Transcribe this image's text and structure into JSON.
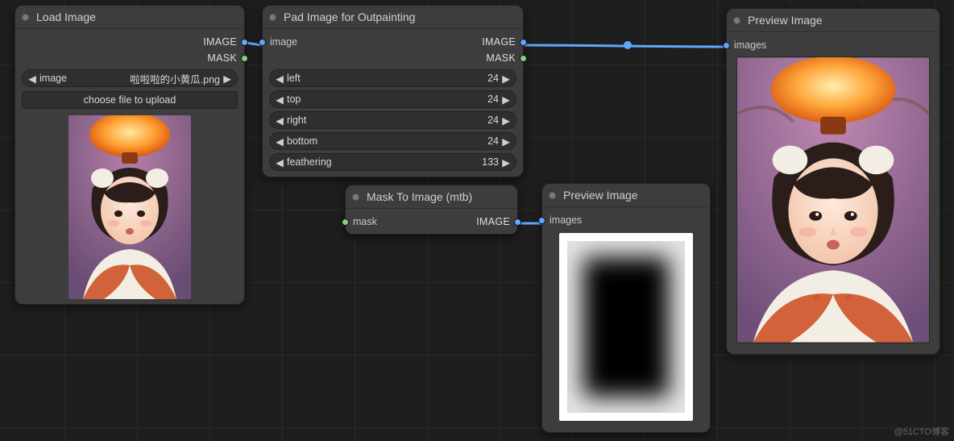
{
  "nodes": {
    "load_image": {
      "title": "Load Image",
      "outputs": {
        "image": "IMAGE",
        "mask": "MASK"
      },
      "file_widget": {
        "label": "image",
        "value": "啦啦啦的小黄瓜.png"
      },
      "upload_btn": "choose file to upload"
    },
    "pad_outpaint": {
      "title": "Pad Image for Outpainting",
      "inputs": {
        "image": "image"
      },
      "outputs": {
        "image": "IMAGE",
        "mask": "MASK"
      },
      "widgets": [
        {
          "label": "left",
          "value": "24"
        },
        {
          "label": "top",
          "value": "24"
        },
        {
          "label": "right",
          "value": "24"
        },
        {
          "label": "bottom",
          "value": "24"
        },
        {
          "label": "feathering",
          "value": "133"
        }
      ]
    },
    "mask_to_image": {
      "title": "Mask To Image (mtb)",
      "inputs": {
        "mask": "mask"
      },
      "outputs": {
        "image": "IMAGE"
      }
    },
    "preview_mask": {
      "title": "Preview Image",
      "inputs": {
        "images": "images"
      }
    },
    "preview_big": {
      "title": "Preview Image",
      "inputs": {
        "images": "images"
      }
    }
  },
  "watermark": "@51CTO博客"
}
